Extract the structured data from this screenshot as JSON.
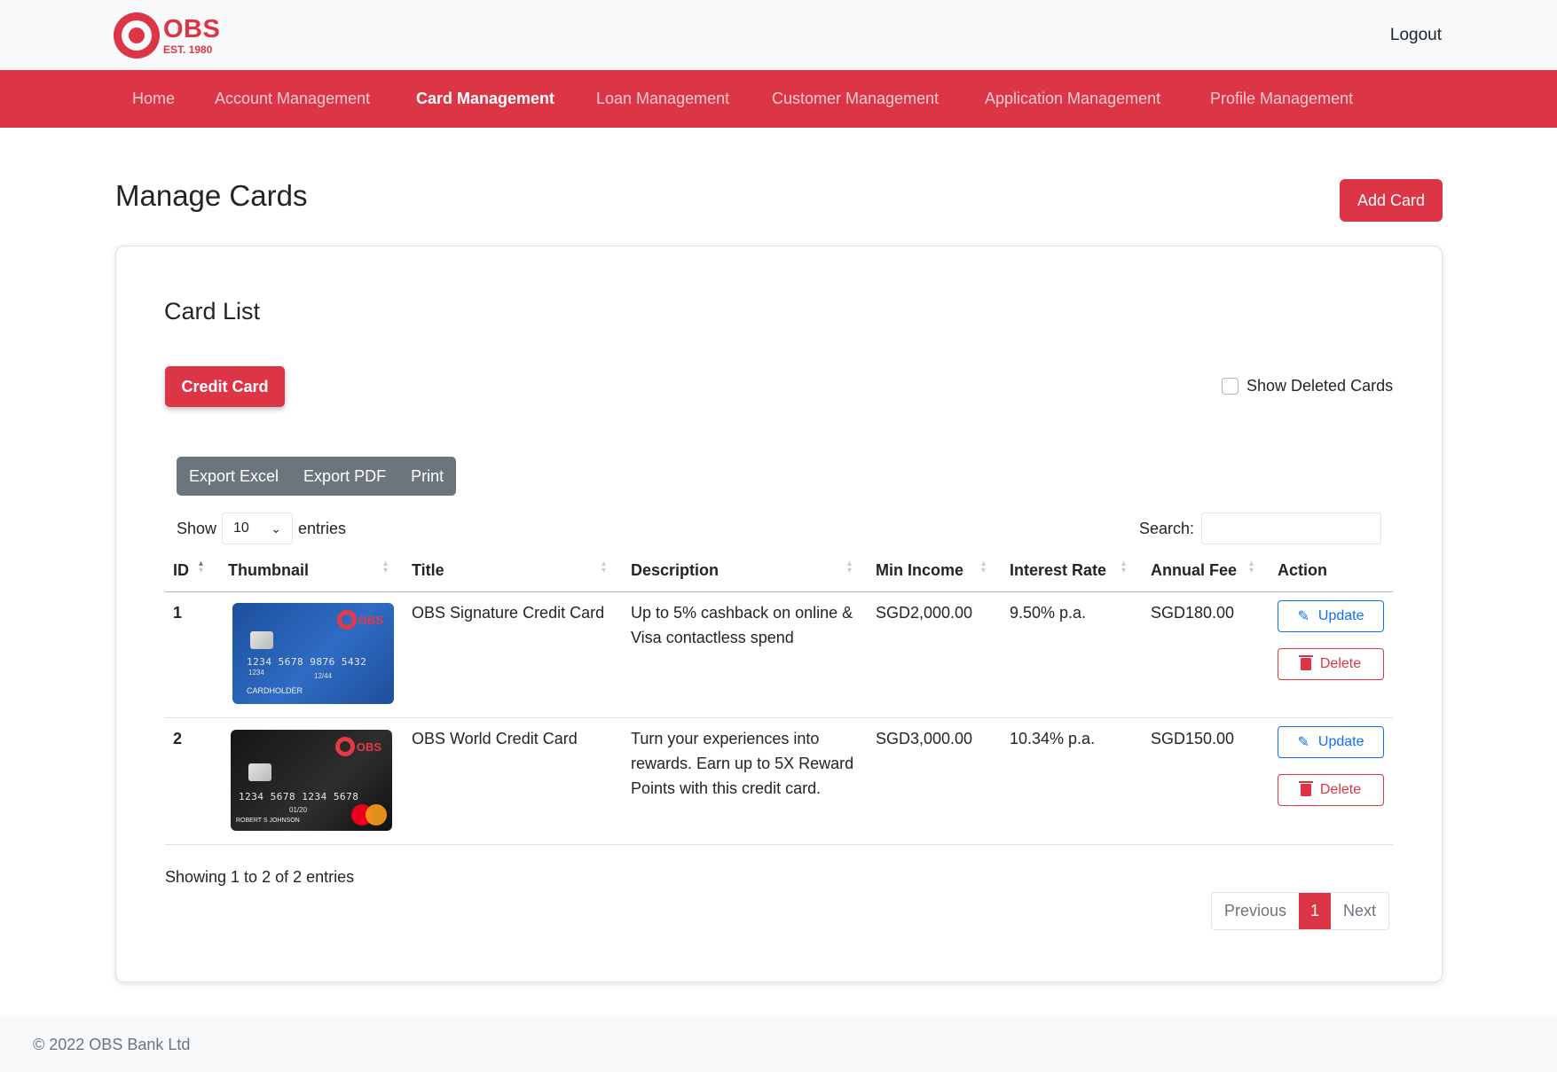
{
  "brand": {
    "name": "OBS",
    "tagline": "EST. 1980",
    "accent_color": "#dc3545"
  },
  "header": {
    "logout_label": "Logout"
  },
  "nav": {
    "items": [
      {
        "label": "Home",
        "active": false
      },
      {
        "label": "Account Management",
        "active": false
      },
      {
        "label": "Card Management",
        "active": true
      },
      {
        "label": "Loan Management",
        "active": false
      },
      {
        "label": "Customer Management",
        "active": false
      },
      {
        "label": "Application Management",
        "active": false
      },
      {
        "label": "Profile Management",
        "active": false
      }
    ]
  },
  "page": {
    "title": "Manage Cards",
    "add_button_label": "Add Card"
  },
  "card_list": {
    "title": "Card List",
    "type_button_label": "Credit Card",
    "show_deleted_label": "Show Deleted Cards",
    "show_deleted_checked": false,
    "export_buttons": [
      "Export Excel",
      "Export PDF",
      "Print"
    ],
    "length": {
      "prefix": "Show",
      "value": "10",
      "suffix": "entries"
    },
    "search": {
      "label": "Search:",
      "value": "",
      "placeholder": ""
    },
    "columns": [
      "ID",
      "Thumbnail",
      "Title",
      "Description",
      "Min Income",
      "Interest Rate",
      "Annual Fee",
      "Action"
    ],
    "rows": [
      {
        "id": "1",
        "thumbnail": {
          "style": "blue",
          "card_number": "1234  5678  9876  5432",
          "small_number": "1234",
          "expiry": "12/44",
          "holder": "CARDHOLDER",
          "mini_logo": "OBS"
        },
        "title": "OBS Signature Credit Card",
        "description": "Up to 5% cashback on online & Visa contactless spend",
        "min_income": "SGD2,000.00",
        "interest_rate": "9.50% p.a.",
        "annual_fee": "SGD180.00",
        "update_label": "Update",
        "delete_label": "Delete"
      },
      {
        "id": "2",
        "thumbnail": {
          "style": "black",
          "card_number": "1234  5678  1234  5678",
          "small_number": "",
          "expiry": "01/20",
          "holder": "ROBERT S JOHNSON",
          "mini_logo": "OBS",
          "network": "MasterCard"
        },
        "title": "OBS World Credit Card",
        "description": "Turn your experiences into rewards. Earn up to 5X Reward Points with this credit card.",
        "min_income": "SGD3,000.00",
        "interest_rate": "10.34% p.a.",
        "annual_fee": "SGD150.00",
        "update_label": "Update",
        "delete_label": "Delete"
      }
    ],
    "info": "Showing 1 to 2 of 2 entries",
    "pagination": {
      "previous": "Previous",
      "current": "1",
      "next": "Next"
    }
  },
  "footer": {
    "text": "© 2022 OBS Bank Ltd"
  }
}
